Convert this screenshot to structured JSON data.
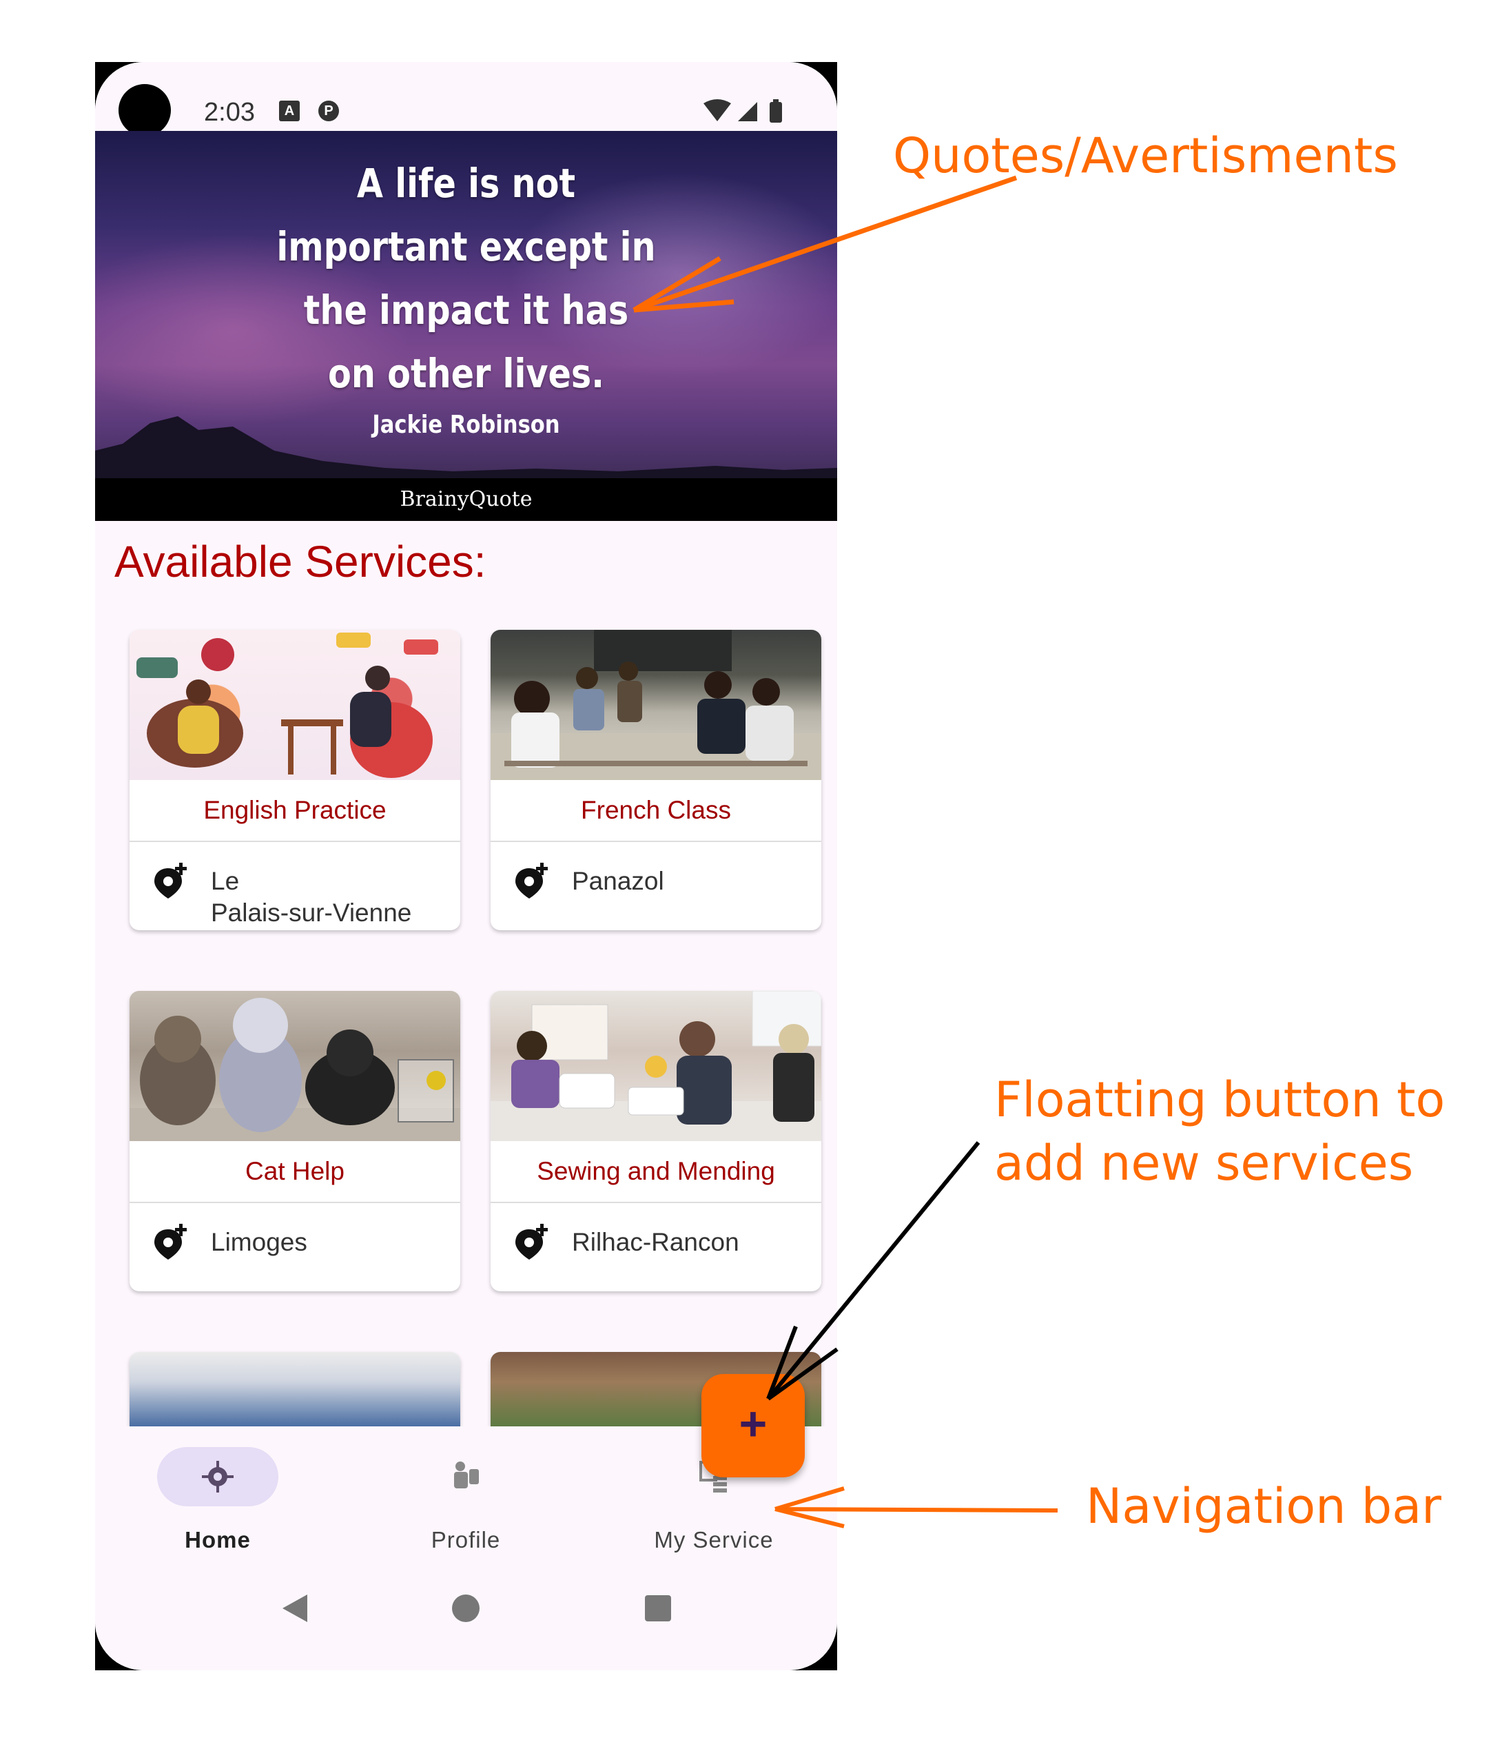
{
  "status_bar": {
    "time": "2:03",
    "icon_a": "A",
    "icon_p": "P"
  },
  "banner": {
    "quote": "A life is not important except in the impact it has on other lives.",
    "quote_lines": [
      "A life is not",
      "important except in",
      "the impact it has",
      "on other lives."
    ],
    "author": "Jackie Robinson",
    "brand": "BrainyQuote"
  },
  "section_title": "Available Services:",
  "services": [
    {
      "name": "English Practice",
      "city_line1": "Le",
      "city_line2": "Palais-sur-Vienne"
    },
    {
      "name": "French Class",
      "city_line1": "Panazol",
      "city_line2": ""
    },
    {
      "name": "Cat Help",
      "city_line1": "Limoges",
      "city_line2": ""
    },
    {
      "name": "Sewing and Mending",
      "city_line1": "Rilhac-Rancon",
      "city_line2": ""
    }
  ],
  "fab": {
    "label": "+"
  },
  "nav": [
    {
      "label": "Home",
      "icon": "home-crosshair-icon",
      "active": true
    },
    {
      "label": "Profile",
      "icon": "profile-icon",
      "active": false
    },
    {
      "label": "My Service",
      "icon": "my-service-icon",
      "active": false
    }
  ],
  "annotations": {
    "quotes": "Quotes/Avertisments",
    "fab_line1": "Floatting button to",
    "fab_line2": "add  new services",
    "navbar": "Navigation bar"
  },
  "colors": {
    "accent": "#ff6a00",
    "title_red": "#b00000",
    "card_title": "#a00000",
    "nav_active_bg": "#e6ddf6"
  }
}
